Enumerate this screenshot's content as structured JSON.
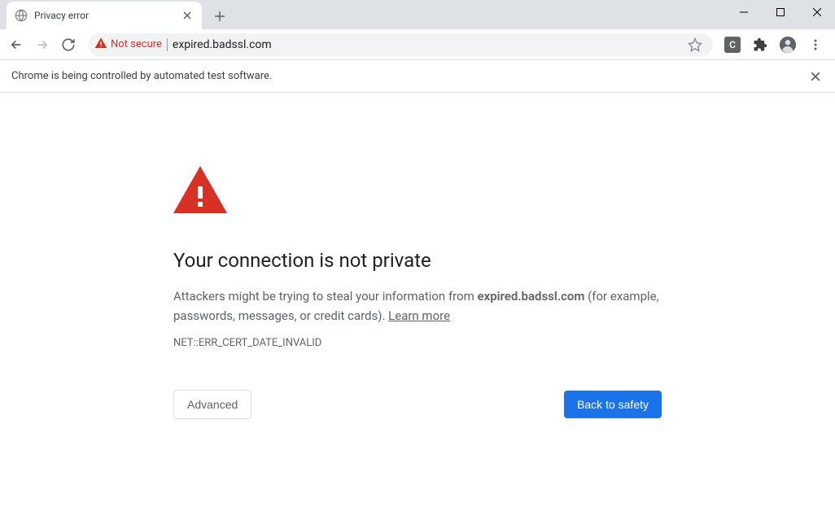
{
  "tab": {
    "title": "Privacy error"
  },
  "toolbar": {
    "security_label": "Not secure",
    "url": "expired.badssl.com"
  },
  "infobar": {
    "text": "Chrome is being controlled by automated test software."
  },
  "interstitial": {
    "heading": "Your connection is not private",
    "body_prefix": "Attackers might be trying to steal your information from ",
    "body_domain": "expired.badssl.com",
    "body_suffix": " (for example, passwords, messages, or credit cards). ",
    "learn_more": "Learn more",
    "error_code": "NET::ERR_CERT_DATE_INVALID",
    "advanced_label": "Advanced",
    "back_label": "Back to safety"
  }
}
